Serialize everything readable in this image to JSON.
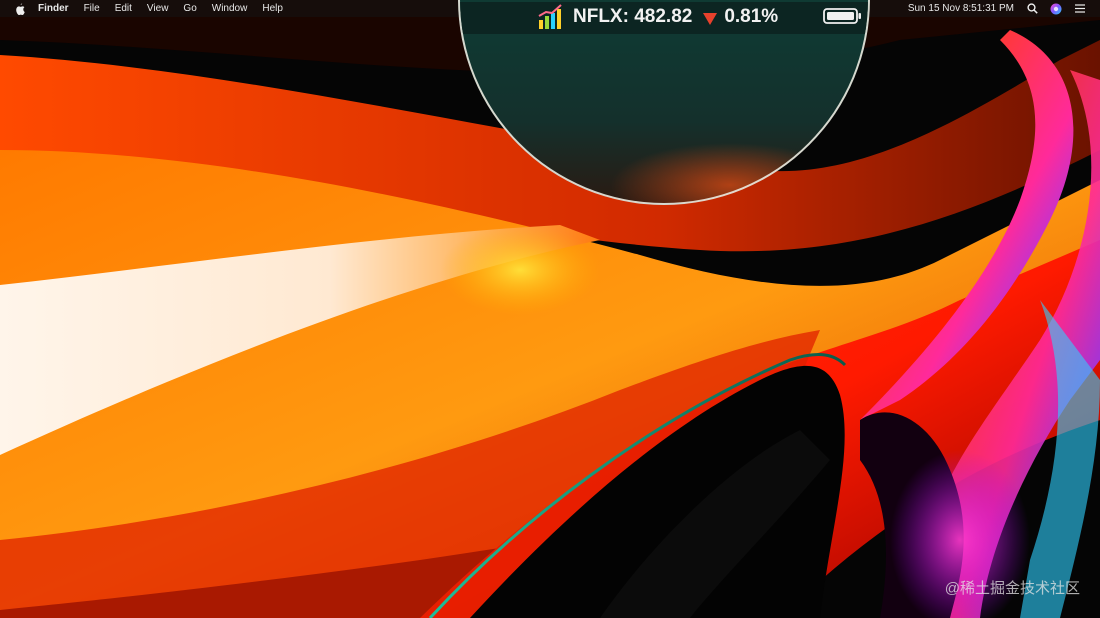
{
  "menubar": {
    "app_name": "Finder",
    "menus": [
      "File",
      "Edit",
      "View",
      "Go",
      "Window",
      "Help"
    ],
    "clock": "Sun 15 Nov  8:51:31 PM",
    "icons": [
      "apple-icon",
      "search-icon",
      "siri-icon",
      "control-menu-icon"
    ]
  },
  "stock_widget": {
    "ticker_label": "NFLX: 482.82",
    "change": "0.81%",
    "direction": "down",
    "down_color": "#e8412c",
    "icon": "stock-chart-icon"
  },
  "battery": {
    "icon": "battery-icon"
  },
  "watermark": "@稀土掘金技术社区",
  "colors": {
    "lens_border": "#ebebe1",
    "lens_tint": "#123a33"
  }
}
